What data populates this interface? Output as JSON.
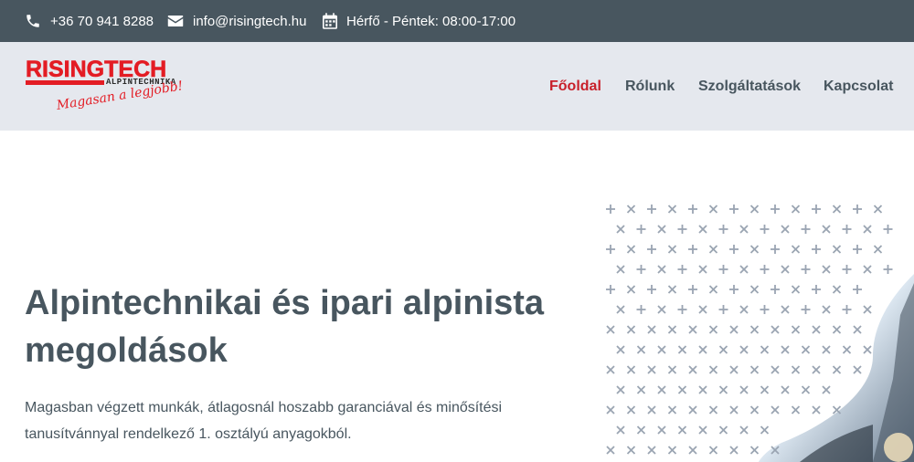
{
  "topbar": {
    "phone": "+36 70 941 8288",
    "email": "info@risingtech.hu",
    "hours": "Hérfő - Péntek: 08:00-17:00"
  },
  "logo": {
    "main": "RISINGTECH",
    "sub": "ALPINTECHNIKA",
    "slogan": "Magasan a legjobb!"
  },
  "nav": {
    "items": [
      {
        "label": "Főoldal",
        "active": true
      },
      {
        "label": "Rólunk",
        "active": false
      },
      {
        "label": "Szolgáltatások",
        "active": false
      },
      {
        "label": "Kapcsolat",
        "active": false
      }
    ]
  },
  "hero": {
    "title": "Alpintechnikai és ipari alpinista megoldások",
    "text": "Magasban végzett munkák, átlagosnál hoszabb garanciával és minősítési tanusítvánnyal rendelkező 1. osztályú anyagokból."
  },
  "colors": {
    "topbar": "#48565f",
    "header": "#e5e8ee",
    "brand_red": "#e31c24",
    "nav_active": "#c8202a",
    "text": "#48565f"
  }
}
